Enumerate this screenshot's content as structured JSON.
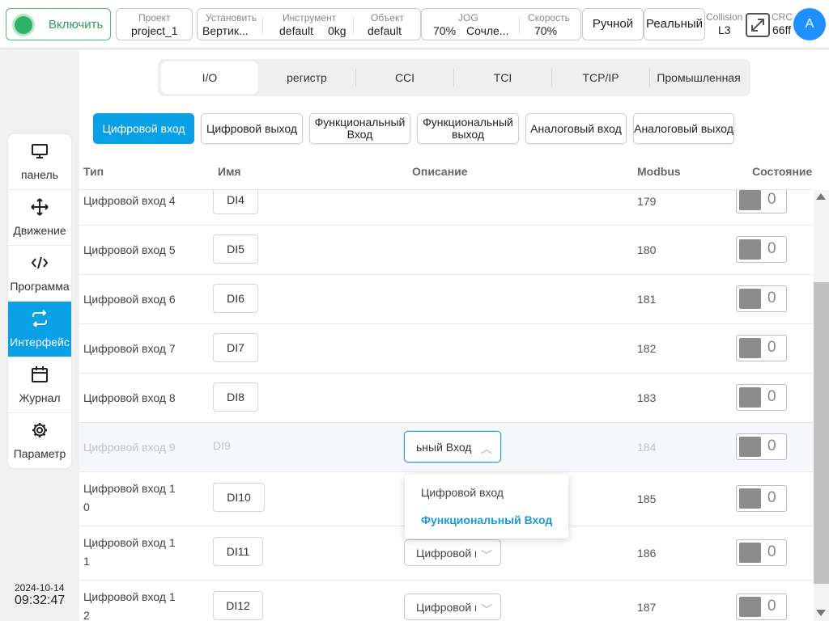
{
  "header": {
    "enable_label": "Включить",
    "project": {
      "label": "Проект",
      "value": "project_1"
    },
    "install": {
      "label": "Установить",
      "value": "Вертик..."
    },
    "tool": {
      "label": "Инструмент",
      "value": "default",
      "weight": "0kg"
    },
    "object": {
      "label": "Объект",
      "value": "default"
    },
    "jog": {
      "label": "JOG",
      "percent": "70%",
      "mode": "Сочле..."
    },
    "speed": {
      "label": "Скорость",
      "value": "70%"
    },
    "manual_label": "Ручной",
    "real_label": "Реальный",
    "collision": {
      "label": "Collision",
      "value": "L3"
    },
    "crc": {
      "label": "CRC",
      "value": "66ff"
    },
    "avatar_letter": "A"
  },
  "sidenav": {
    "items": [
      {
        "label": "панель",
        "icon": "monitor-icon"
      },
      {
        "label": "Движение",
        "icon": "move-icon"
      },
      {
        "label": "Программа",
        "icon": "code-icon"
      },
      {
        "label": "Интерфейс",
        "icon": "swap-arrows-icon",
        "active": true
      },
      {
        "label": "Журнал",
        "icon": "calendar-icon"
      },
      {
        "label": "Параметр",
        "icon": "gear-icon"
      }
    ]
  },
  "clock": {
    "date": "2024-10-14",
    "time": "09:32:47"
  },
  "tabs": [
    "I/O",
    "регистр",
    "CCI",
    "TCI",
    "TCP/IP",
    "Промышленная"
  ],
  "subtabs": [
    "Цифровой вход",
    "Цифровой выход",
    "Функциональный Вход",
    "Функциональный выход",
    "Аналоговый вход",
    "Аналоговый выход"
  ],
  "table": {
    "headers": {
      "type": "Тип",
      "name": "Имя",
      "description": "Описание",
      "modbus": "Modbus",
      "state": "Состояние"
    },
    "rows": [
      {
        "type": "Цифровой вход 4",
        "name": "DI4",
        "modbus": "179",
        "state": "0"
      },
      {
        "type": "Цифровой вход 5",
        "name": "DI5",
        "modbus": "180",
        "state": "0"
      },
      {
        "type": "Цифровой вход 6",
        "name": "DI6",
        "modbus": "181",
        "state": "0"
      },
      {
        "type": "Цифровой вход 7",
        "name": "DI7",
        "modbus": "182",
        "state": "0"
      },
      {
        "type": "Цифровой вход 8",
        "name": "DI8",
        "modbus": "183",
        "state": "0"
      },
      {
        "type": "Цифровой вход 9",
        "name": "DI9",
        "description": "ьный Вход",
        "modbus": "184",
        "state": "0"
      },
      {
        "type": "Цифровой вход 1 0",
        "name": "DI10",
        "modbus": "185",
        "state": "0"
      },
      {
        "type": "Цифровой вход 1 1",
        "name": "DI11",
        "description": "Цифровой в",
        "modbus": "186",
        "state": "0"
      },
      {
        "type": "Цифровой вход 1 2",
        "name": "DI12",
        "description": "Цифровой в",
        "modbus": "187",
        "state": "0"
      }
    ]
  },
  "dropdown": {
    "options": [
      "Цифровой вход",
      "Функциональный Вход"
    ],
    "selected": "Функциональный Вход"
  },
  "colors": {
    "accent": "#0aa0e6",
    "enable_green": "#2fb36a",
    "avatar": "#1e90ff"
  }
}
